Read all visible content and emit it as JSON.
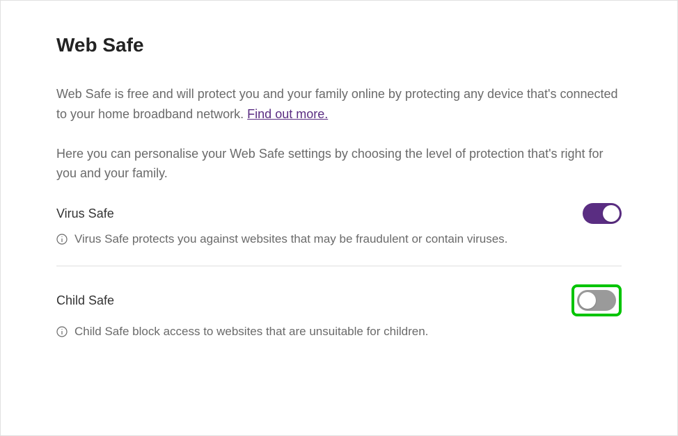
{
  "page": {
    "title": "Web Safe",
    "intro1_pre": "Web Safe is free and will protect you and your family online by protecting any device that's connected to your home broadband network. ",
    "intro1_link": "Find out more.",
    "intro2": "Here you can personalise your Web Safe settings by choosing the level of protection that's right for you and your family."
  },
  "virus_safe": {
    "title": "Virus Safe",
    "description": "Virus Safe protects you against websites that may be fraudulent or contain viruses.",
    "enabled": true
  },
  "child_safe": {
    "title": "Child Safe",
    "description": "Child Safe block access to websites that are unsuitable for children.",
    "enabled": false
  },
  "colors": {
    "accent": "#5a2d82",
    "highlight": "#00c400"
  }
}
